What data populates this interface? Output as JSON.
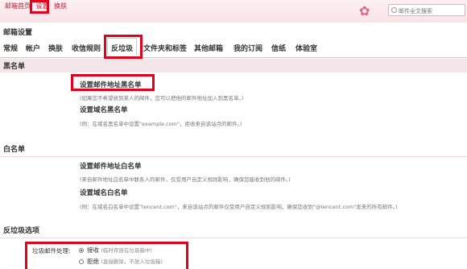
{
  "topbar": {
    "links": [
      "邮箱首页",
      "设置",
      "换肤"
    ],
    "search_placeholder": "邮件全文搜索"
  },
  "page_title": "邮箱设置",
  "tabs": [
    "常规",
    "帐户",
    "换肤",
    "收信规则",
    "反垃圾",
    "文件夹和标签",
    "其他邮箱",
    "我的订阅",
    "信纸",
    "体验室"
  ],
  "active_tab": "反垃圾",
  "blacklist": {
    "title": "黑名单",
    "address_link": "设置邮件地址黑名单",
    "address_note": "(如果您不希望收到某人的邮件，您可以把他的邮件地址加入到黑名单。)",
    "domain_link": "设置域名黑名单",
    "domain_note": "(例：在域名黑名单中设置\"example.com\"，拒收来自该站点的邮件。)"
  },
  "whitelist": {
    "title": "白名单",
    "address_link": "设置邮件地址白名单",
    "address_note": "(来自邮件地址白名单中联系人的邮件，仅受用户自定义规则影响，确保您能收到他的邮件。)",
    "domain_link": "设置域名白名单",
    "domain_note": "(例：在域名白名单中设置\"tencent.com\"，来自该站点的邮件仅受用户自定义规则影响，确保您收到\"@tencent.com\"发来的所有邮件。)"
  },
  "options": {
    "title": "反垃圾选项",
    "label": "垃圾邮件处理:",
    "accept": "接收",
    "accept_note": "(临时存放在垃圾箱中)",
    "reject": "拒绝",
    "reject_note": "(直接删除，不放入垃圾箱)",
    "selected": "接收"
  }
}
